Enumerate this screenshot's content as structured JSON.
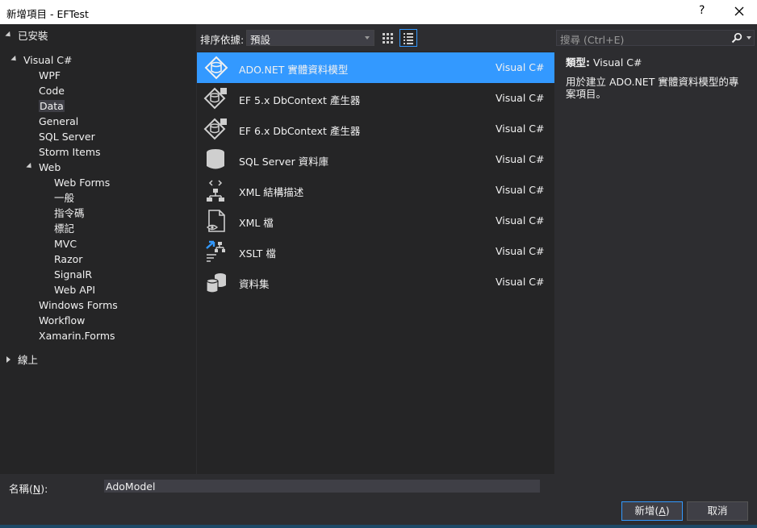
{
  "window": {
    "title": "新增項目 - EFTest",
    "help": "?"
  },
  "tree": {
    "installed": "已安裝",
    "visual_csharp": "Visual C#",
    "wpf": "WPF",
    "code": "Code",
    "data": "Data",
    "general": "General",
    "sql_server": "SQL Server",
    "storm_items": "Storm Items",
    "web": "Web",
    "web_forms": "Web Forms",
    "yiban": "一般",
    "script": "指令碼",
    "markup": "標記",
    "mvc": "MVC",
    "razor": "Razor",
    "signalr": "SignalR",
    "web_api": "Web API",
    "windows_forms": "Windows Forms",
    "workflow": "Workflow",
    "xamarin_forms": "Xamarin.Forms",
    "online": "線上"
  },
  "toolbar": {
    "sort_label": "排序依據:",
    "sort_value": "預設"
  },
  "items": [
    {
      "name": "ADO.NET 實體資料模型",
      "lang": "Visual C#",
      "icon": "ado-model-icon"
    },
    {
      "name": "EF 5.x DbContext 產生器",
      "lang": "Visual C#",
      "icon": "ef-generator-icon"
    },
    {
      "name": "EF 6.x DbContext 產生器",
      "lang": "Visual C#",
      "icon": "ef-generator-icon"
    },
    {
      "name": "SQL Server 資料庫",
      "lang": "Visual C#",
      "icon": "database-icon"
    },
    {
      "name": "XML 結構描述",
      "lang": "Visual C#",
      "icon": "xml-schema-icon"
    },
    {
      "name": "XML 檔",
      "lang": "Visual C#",
      "icon": "xml-file-icon"
    },
    {
      "name": "XSLT 檔",
      "lang": "Visual C#",
      "icon": "xslt-file-icon"
    },
    {
      "name": "資料集",
      "lang": "Visual C#",
      "icon": "dataset-icon"
    }
  ],
  "search": {
    "placeholder": "搜尋 (Ctrl+E)"
  },
  "description": {
    "type_label": "類型:",
    "type_value": "Visual C#",
    "text": "用於建立 ADO.NET 實體資料模型的專案項目。"
  },
  "bottom": {
    "name_label": "名稱",
    "name_key": "N",
    "name_value": "AdoModel",
    "add_label": "新增",
    "add_key": "A",
    "cancel_label": "取消"
  },
  "colors": {
    "accent": "#3399ff",
    "background": "#2d2d30",
    "panel": "#252526"
  }
}
